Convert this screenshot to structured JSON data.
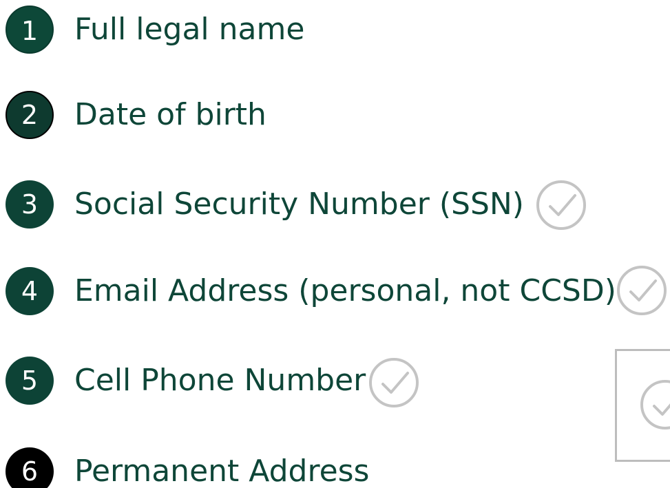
{
  "checklist": {
    "items": [
      {
        "number": "1",
        "label": "Full legal name",
        "checked": false
      },
      {
        "number": "2",
        "label": "Date of birth",
        "checked": false
      },
      {
        "number": "3",
        "label": "Social Security Number (SSN)",
        "checked": true,
        "check_icon": "check-circle-icon"
      },
      {
        "number": "4",
        "label": "Email Address (personal, not CCSD)",
        "checked": true,
        "check_icon": "check-circle-icon"
      },
      {
        "number": "5",
        "label": "Cell Phone Number",
        "checked": true,
        "check_icon": "check-circle-icon"
      },
      {
        "number": "6",
        "label": "Permanent Address",
        "checked": false
      }
    ],
    "side_box": {
      "check_icon": "check-circle-icon"
    }
  },
  "colors": {
    "badge_green": "#0d4838",
    "label_green": "#0e4638",
    "check_gray": "#c4c4c4",
    "box_border": "#bdbdbd"
  }
}
